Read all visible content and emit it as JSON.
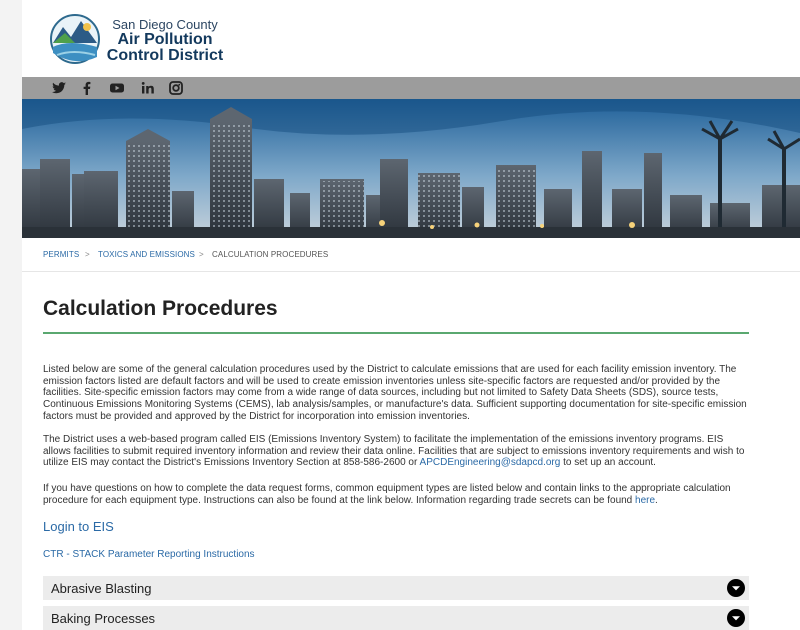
{
  "brand": {
    "line1": "San Diego County",
    "line2": "Air Pollution",
    "line3": "Control District"
  },
  "social": [
    "twitter-icon",
    "facebook-icon",
    "youtube-icon",
    "linkedin-icon",
    "instagram-icon"
  ],
  "breadcrumb": {
    "items": [
      "PERMITS",
      "TOXICS AND EMISSIONS",
      "CALCULATION PROCEDURES"
    ],
    "separator": ">"
  },
  "page": {
    "title": "Calculation Procedures",
    "para1": "Listed below are some of the general calculation procedures used by the District to calculate emissions that are used for each facility emission inventory. The emission factors listed are default factors and will be used to create emission inventories unless site-specific factors are requested and/or provided by the facilities. Site-specific emission factors may come from a wide range of data sources, including but not limited to Safety Data Sheets (SDS), source tests, Continuous Emissions Monitoring Systems (CEMS), lab analysis/samples, or manufacture's data. Sufficient supporting documentation for site-specific emission factors must be provided and approved by the District for incorporation into emission inventories.",
    "para2_text": "The District uses a web-based program called EIS (Emissions Inventory System) to facilitate the implementation of the emissions inventory programs. EIS allows facilities to submit required inventory information and review their data online. Facilities that are subject to emissions inventory requirements and wish to utilize EIS may contact the District's Emissions Inventory Section at 858-586-2600 or ",
    "para2_email": "APCDEngineering@sdapcd.org",
    "para2_end": " to set up an account.",
    "para3_text": "If you have questions on how to complete the data request forms, common equipment types are listed below and contain links to the appropriate calculation procedure for each equipment type. Instructions can also be found at the link below. Information regarding trade secrets can be found ",
    "para3_link": "here",
    "para3_end": ".",
    "login_link": "Login to EIS",
    "ctr_link": "CTR - STACK Parameter Reporting Instructions"
  },
  "accordion": [
    "Abrasive Blasting",
    "Baking Processes"
  ],
  "colors": {
    "accent_green": "#5aa870",
    "link_blue": "#2b6aa6",
    "social_bar": "#9c9c9c"
  }
}
